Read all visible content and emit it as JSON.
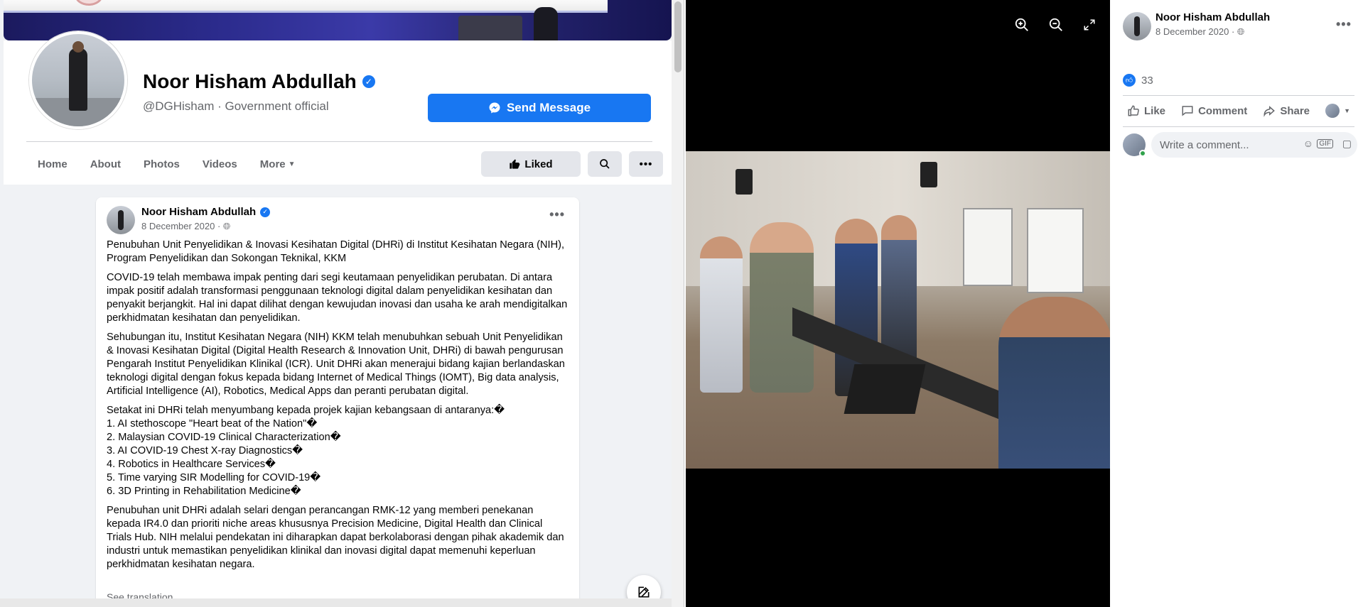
{
  "profile": {
    "name": "Noor Hisham Abdullah",
    "handle_line": "@DGHisham · Government official",
    "send_message": "Send Message",
    "nav": [
      "Home",
      "About",
      "Photos",
      "Videos",
      "More"
    ],
    "liked_label": "Liked"
  },
  "post": {
    "author": "Noor Hisham Abdullah",
    "date": "8 December 2020 · ",
    "p1": "Penubuhan Unit Penyelidikan & Inovasi Kesihatan Digital (DHRi) di Institut Kesihatan Negara (NIH), Program Penyelidikan dan Sokongan Teknikal, KKM",
    "p2": "COVID-19 telah membawa impak penting dari segi keutamaan penyelidikan perubatan. Di antara impak positif adalah transformasi penggunaan teknologi digital dalam penyelidikan kesihatan dan penyakit berjangkit. Hal ini dapat dilihat dengan kewujudan inovasi dan usaha ke arah mendigitalkan perkhidmatan kesihatan dan penyelidikan.",
    "p3": "Sehubungan itu, Institut Kesihatan Negara (NIH) KKM telah menubuhkan sebuah Unit Penyelidikan & Inovasi Kesihatan Digital (Digital Health Research & Innovation Unit, DHRi) di bawah pengurusan Pengarah Institut Penyelidikan Klinikal (ICR). Unit DHRi akan menerajui bidang kajian berlandaskan teknologi digital dengan fokus kepada bidang Internet of Medical Things (IOMT), Big data analysis, Artificial Intelligence (AI), Robotics, Medical Apps dan peranti perubatan digital.",
    "list_intro": "Setakat ini DHRi telah menyumbang kepada projek kajian kebangsaan di antaranya:�",
    "list": [
      "1. AI stethoscope \"Heart beat of the Nation\"�",
      "2. Malaysian COVID-19 Clinical Characterization�",
      "3. AI COVID-19 Chest X-ray Diagnostics�",
      "4. Robotics in Healthcare Services�",
      "5. Time varying SIR Modelling for COVID-19�",
      "6. 3D Printing in Rehabilitation Medicine�"
    ],
    "p5": "Penubuhan unit DHRi adalah selari dengan perancangan RMK-12 yang memberi penekanan kepada IR4.0 dan prioriti niche areas khususnya Precision Medicine, Digital Health dan Clinical Trials Hub. NIH melalui pendekatan ini diharapkan dapat berkolaborasi dengan pihak akademik dan industri untuk memastikan penyelidikan klinikal dan inovasi digital dapat memenuhi keperluan perkhidmatan kesihatan negara.",
    "see_translation": "See translation"
  },
  "sidebar": {
    "author": "Noor Hisham Abdullah",
    "date": "8 December 2020 · ",
    "reaction_count": "33",
    "actions": [
      "Like",
      "Comment",
      "Share"
    ],
    "comment_placeholder": "Write a comment..."
  },
  "icons": {
    "verified": "verified-badge-icon",
    "messenger": "messenger-icon",
    "zoom_in": "zoom-in-icon",
    "zoom_out": "zoom-out-icon",
    "fullscreen": "fullscreen-icon",
    "globe": "globe-icon"
  },
  "colors": {
    "accent": "#1877f2",
    "text": "#050505",
    "muted": "#65676b",
    "viewer_bg": "#000000"
  }
}
